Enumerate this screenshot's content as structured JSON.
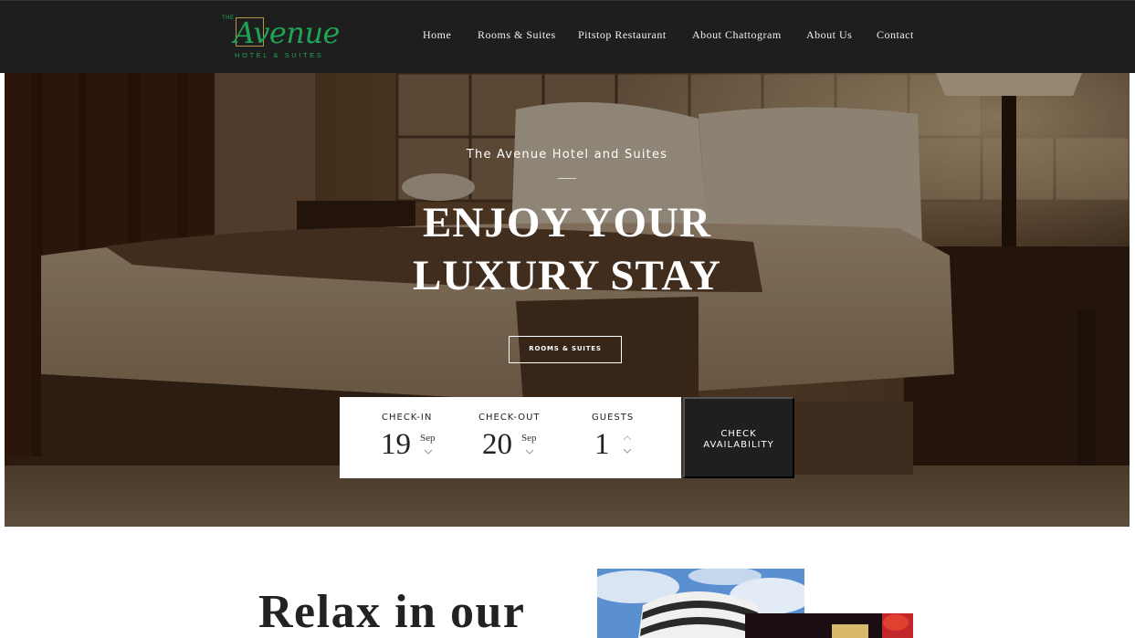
{
  "brand": {
    "prefix": "THE",
    "name": "Avenue",
    "tagline": "HOTEL & SUITES",
    "color": "#1fa456"
  },
  "nav": {
    "items": [
      {
        "label": "Home"
      },
      {
        "label": "Rooms & Suites"
      },
      {
        "label": "Pitstop Restaurant"
      },
      {
        "label": "About Chattogram"
      },
      {
        "label": "About Us"
      },
      {
        "label": "Contact"
      }
    ]
  },
  "hero": {
    "kicker": "The Avenue Hotel and Suites",
    "title_line1": "ENJOY YOUR",
    "title_line2": "LUXURY STAY",
    "button_label": "ROOMS & SUITES"
  },
  "booking": {
    "checkin": {
      "label": "CHECK-IN",
      "day": "19",
      "month": "Sep"
    },
    "checkout": {
      "label": "CHECK-OUT",
      "day": "20",
      "month": "Sep"
    },
    "guests": {
      "label": "GUESTS",
      "value": "1"
    },
    "submit_line1": "CHECK",
    "submit_line2": "AVAILABILITY"
  },
  "intro": {
    "heading": "Relax in our"
  },
  "colors": {
    "header_bg": "#1e1e1e",
    "accent_gold": "#b8944a",
    "dark_button": "#1f1f1f"
  }
}
